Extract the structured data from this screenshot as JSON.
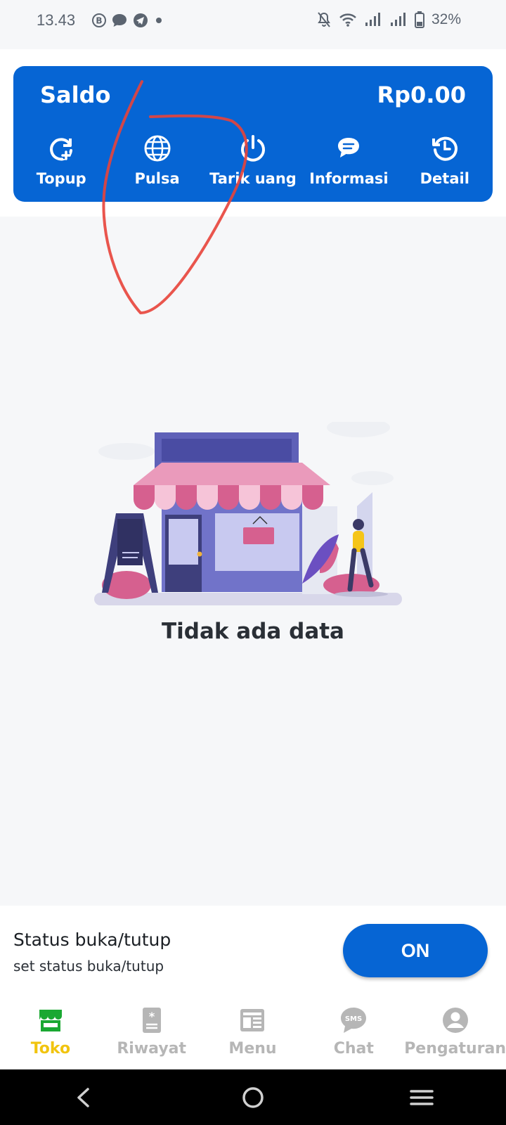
{
  "status_bar": {
    "time": "13.43",
    "battery_percent": "32%"
  },
  "wallet": {
    "label": "Saldo",
    "amount": "Rp0.00",
    "actions": [
      {
        "label": "Topup",
        "icon": "refresh-plus-icon"
      },
      {
        "label": "Pulsa",
        "icon": "globe-icon"
      },
      {
        "label": "Tarik uang",
        "icon": "power-icon"
      },
      {
        "label": "Informasi",
        "icon": "chat-icon"
      },
      {
        "label": "Detail",
        "icon": "history-icon"
      }
    ]
  },
  "empty_state": {
    "message": "Tidak ada data",
    "illustration": "store-front-icon"
  },
  "store_status": {
    "title": "Status buka/tutup",
    "subtitle": "set status buka/tutup",
    "toggle_label": "ON"
  },
  "bottom_nav": {
    "items": [
      {
        "label": "Toko",
        "icon": "store-icon",
        "active": true
      },
      {
        "label": "Riwayat",
        "icon": "receipt-icon",
        "active": false
      },
      {
        "label": "Menu",
        "icon": "menu-book-icon",
        "active": false
      },
      {
        "label": "Chat",
        "icon": "sms-icon",
        "active": false
      },
      {
        "label": "Pengaturan",
        "icon": "account-icon",
        "active": false
      }
    ]
  },
  "colors": {
    "primary": "#0665d4",
    "active_nav": "#f1c40f",
    "inactive_nav": "#b6b6b6",
    "store_green": "#1aa832",
    "annotation_red": "#e8423a"
  }
}
